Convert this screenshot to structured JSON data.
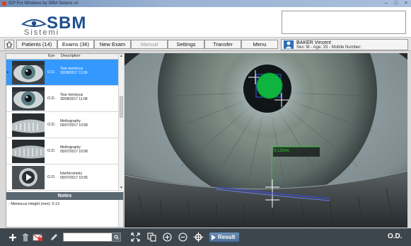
{
  "window": {
    "title": "ICP For Windows by SBM Sistemi srl",
    "controls": {
      "minimize": "–",
      "maximize": "□",
      "close": "×"
    }
  },
  "logo": {
    "main": "SBM",
    "sub": "Sistemi"
  },
  "nav": {
    "home_icon": "home-icon",
    "tabs": [
      {
        "label": "Patients (14)"
      },
      {
        "label": "Exams (36)"
      },
      {
        "label": "New Exam"
      },
      {
        "label": "Manual"
      },
      {
        "label": "Settings"
      },
      {
        "label": "Transfer"
      },
      {
        "label": "Menu"
      }
    ]
  },
  "patient": {
    "name": "BAKER Vincent",
    "info": "Sex: M - Age: 33 - Mobile Number:"
  },
  "exam_list": {
    "columns": {
      "eye": "Eye",
      "description": "Description"
    },
    "rows": [
      {
        "eye": "O.D.",
        "title": "Tear meniscus",
        "date": "30/08/2017 11:09",
        "selected": true,
        "marker": "▸"
      },
      {
        "eye": "O.D.",
        "title": "Tear meniscus",
        "date": "30/08/2017 11:08",
        "selected": false,
        "marker": ""
      },
      {
        "eye": "O.D.",
        "title": "Meibography",
        "date": "05/07/2017 10:58",
        "selected": false,
        "marker": ""
      },
      {
        "eye": "O.D.",
        "title": "Meibography",
        "date": "05/07/2017 10:58",
        "selected": false,
        "marker": ""
      },
      {
        "eye": "O.D.",
        "title": "Interferometry",
        "date": "05/07/2017 10:56",
        "selected": false,
        "marker": ""
      }
    ]
  },
  "notes": {
    "header": "Notes",
    "text": "- Meniscus Height (mm): 0.12"
  },
  "viewer": {
    "measurement": "0.12mm"
  },
  "bottom": {
    "search": {
      "value": "",
      "placeholder": ""
    },
    "result_label": "Result",
    "eye_label": "O.D."
  },
  "colors": {
    "selection": "#3399ff",
    "toolbar_bg": "#3e464d",
    "notes_header": "#5a6872",
    "pupil_marker": "#0fb33f",
    "measure_green": "#3ad13a",
    "meniscus_line": "#3a4bd8",
    "brand_blue": "#1e4f8c"
  }
}
